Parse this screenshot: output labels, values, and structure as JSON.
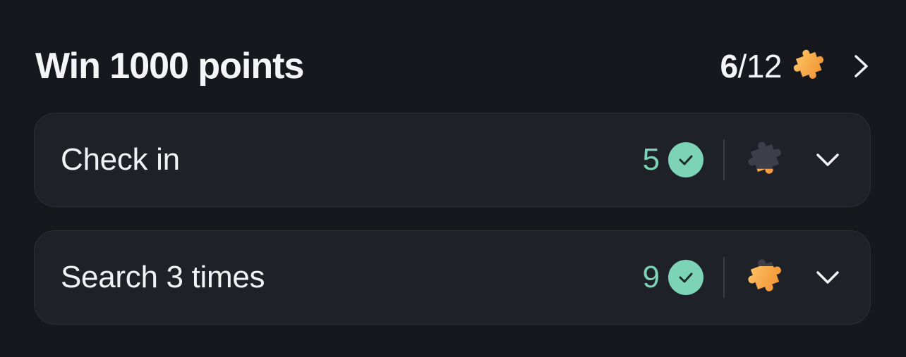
{
  "header": {
    "title": "Win 1000 points",
    "progress_done": "6",
    "progress_total": "/12",
    "puzzle_icon": "puzzle-piece-icon",
    "more_icon": "chevron-right-icon"
  },
  "tasks": [
    {
      "label": "Check in",
      "count": "5",
      "status_icon": "check-circle-icon",
      "reward_icon": "puzzle-piece-icon",
      "reward_progress": 0.3,
      "expand_icon": "chevron-down-icon"
    },
    {
      "label": "Search 3 times",
      "count": "9",
      "status_icon": "check-circle-icon",
      "reward_icon": "puzzle-piece-icon",
      "reward_progress": 0.75,
      "expand_icon": "chevron-down-icon"
    }
  ],
  "colors": {
    "background": "#17181d",
    "card": "#1f2129",
    "accent_green": "#7dd3b5",
    "puzzle_orange": "#f5a83a",
    "puzzle_gray": "#3c3f4a"
  }
}
